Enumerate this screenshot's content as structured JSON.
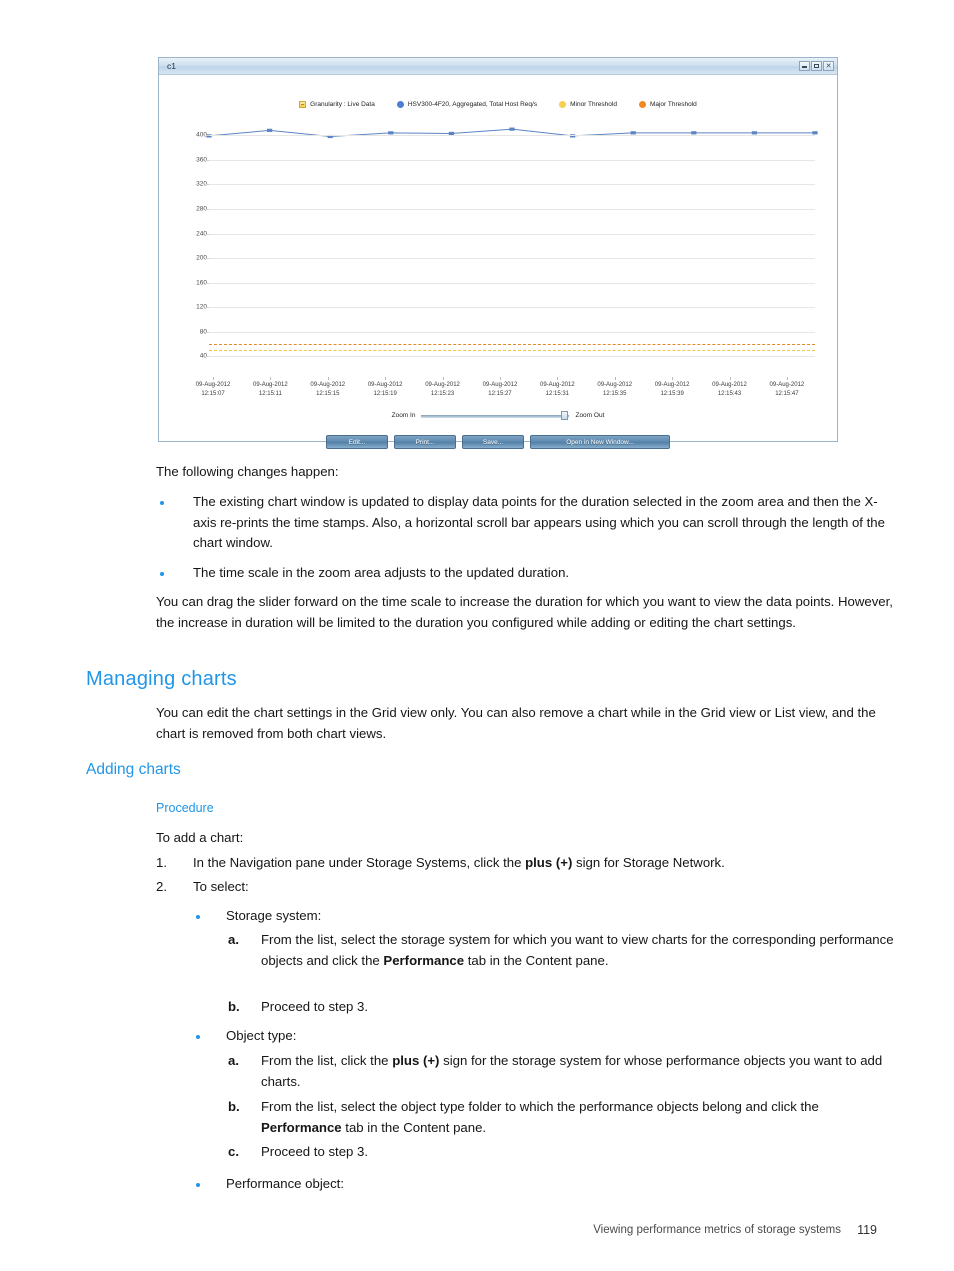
{
  "chart_window": {
    "title": "c1",
    "window_controls": [
      "minimize-icon",
      "maximize-icon",
      "close-icon"
    ],
    "legend": [
      {
        "label": "Granularity : Live Data",
        "swatch": "square",
        "color": "#f3ca57"
      },
      {
        "label": "HSV300-4F20, Aggregated, Total Host Req/s",
        "swatch": "dot",
        "color": "#4d7fd1"
      },
      {
        "label": "Minor Threshold",
        "swatch": "dot",
        "color": "#f7cf4f"
      },
      {
        "label": "Major Threshold",
        "swatch": "dot",
        "color": "#ef8a21"
      }
    ],
    "zoom": {
      "in_label": "Zoom In",
      "out_label": "Zoom Out",
      "slider_value": 97
    },
    "buttons": [
      {
        "label": "Edit...",
        "wide": false
      },
      {
        "label": "Print...",
        "wide": false
      },
      {
        "label": "Save...",
        "wide": false
      },
      {
        "label": "Open in New Window...",
        "wide": true
      }
    ]
  },
  "chart_data": {
    "type": "line",
    "title": "",
    "xlabel": "",
    "ylabel": "",
    "ylim": [
      0,
      420
    ],
    "yticks": [
      400,
      360,
      320,
      280,
      240,
      200,
      160,
      120,
      80,
      40
    ],
    "grid": true,
    "legend_position": "top-center",
    "x": [
      "09-Aug-2012 12:15:07",
      "09-Aug-2012 12:15:11",
      "09-Aug-2012 12:15:15",
      "09-Aug-2012 12:15:19",
      "09-Aug-2012 12:15:23",
      "09-Aug-2012 12:15:27",
      "09-Aug-2012 12:15:31",
      "09-Aug-2012 12:15:35",
      "09-Aug-2012 12:15:39",
      "09-Aug-2012 12:15:43",
      "09-Aug-2012 12:15:47"
    ],
    "x_tick_dates": [
      "09-Aug-2012",
      "09-Aug-2012",
      "09-Aug-2012",
      "09-Aug-2012",
      "09-Aug-2012",
      "09-Aug-2012",
      "09-Aug-2012",
      "09-Aug-2012",
      "09-Aug-2012",
      "09-Aug-2012",
      "09-Aug-2012"
    ],
    "x_tick_times": [
      "12:15:07",
      "12:15:11",
      "12:15:15",
      "12:15:19",
      "12:15:23",
      "12:15:27",
      "12:15:31",
      "12:15:35",
      "12:15:39",
      "12:15:43",
      "12:15:47"
    ],
    "series": [
      {
        "name": "HSV300-4F20, Aggregated, Total Host Req/s",
        "color": "#5b84c4",
        "values": [
          399,
          408,
          398,
          404,
          403,
          410,
          399,
          404,
          404,
          404,
          404
        ]
      }
    ],
    "thresholds": [
      {
        "name": "Major Threshold",
        "value": 60,
        "color": "#e08b28",
        "style": "dashed"
      },
      {
        "name": "Minor Threshold",
        "value": 50,
        "color": "#edc84a",
        "style": "dashed"
      }
    ]
  },
  "doc": {
    "intro": "The following changes happen:",
    "bullets_1": [
      "The existing chart window is updated to display data points for the duration selected in the zoom area and then the X-axis re-prints the time stamps. Also, a horizontal scroll bar appears using which you can scroll through the length of the chart window.",
      "The time scale in the zoom area adjusts to the updated duration."
    ],
    "para_after_bullets": "You can drag the slider forward on the time scale to increase the duration for which you want to view the data points. However, the increase in duration will be limited to the duration you configured while adding or editing the chart settings.",
    "heading_managing": "Managing charts",
    "managing_body": "You can edit the chart settings in the Grid view only. You can also remove a chart while in the Grid view or List view, and the chart is removed from both chart views.",
    "heading_adding": "Adding charts",
    "heading_procedure": "Procedure",
    "to_add": "To add a chart:",
    "step1_num": "1.",
    "step1_pre": "In the Navigation pane under Storage Systems, click the ",
    "step1_bold": "plus (+)",
    "step1_post": " sign for Storage Network.",
    "step2_num": "2.",
    "step2_text": "To select:",
    "sub1_label": "Storage system:",
    "sub1_a_marker": "a.",
    "sub1_a_pre": "From the list, select the storage system for which you want to view charts for the corresponding performance objects and click the ",
    "sub1_a_bold": "Performance",
    "sub1_a_post": " tab in the Content pane.",
    "sub1_b_marker": "b.",
    "sub1_b_text": "Proceed to step 3.",
    "sub2_label": "Object type:",
    "sub2_a_marker": "a.",
    "sub2_a_pre": "From the list, click the ",
    "sub2_a_bold": "plus (+)",
    "sub2_a_post": " sign for the storage system for whose performance objects you want to add charts.",
    "sub2_b_marker": "b.",
    "sub2_b_pre": "From the list, select the object type folder to which the performance objects belong and click the ",
    "sub2_b_bold": "Performance",
    "sub2_b_post": " tab in the Content pane.",
    "sub2_c_marker": "c.",
    "sub2_c_text": "Proceed to step 3.",
    "sub3_label": "Performance object:"
  },
  "footer": {
    "text": "Viewing performance metrics of storage systems",
    "page": "119"
  }
}
